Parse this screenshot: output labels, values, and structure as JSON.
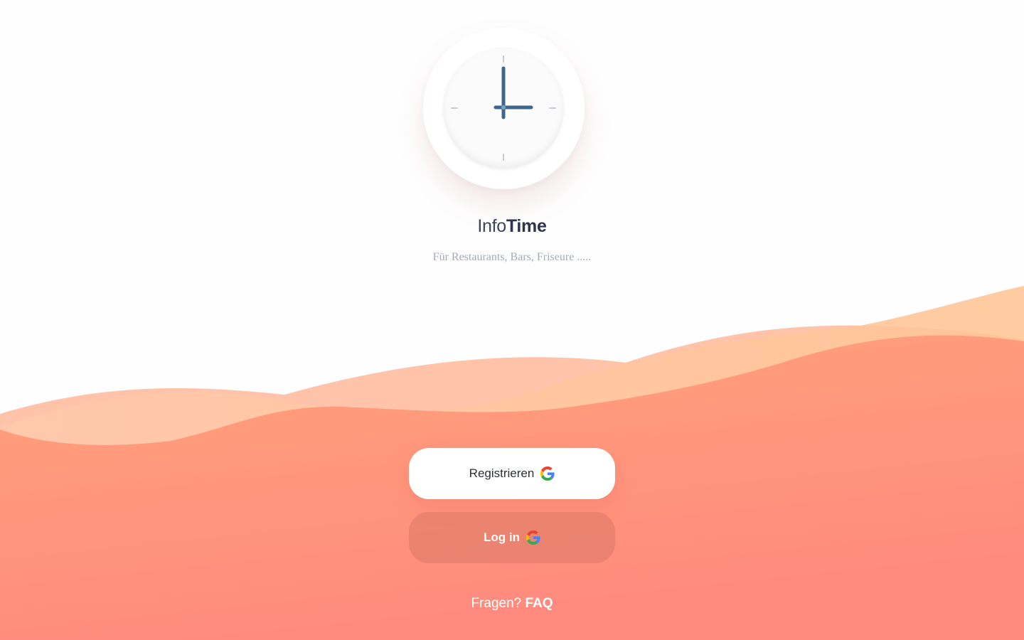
{
  "brand": {
    "name_light": "Info",
    "name_bold": "Time",
    "tagline": "Für Restaurants, Bars, Friseure ....."
  },
  "clock": {
    "icon": "clock-icon",
    "time": "3:00"
  },
  "buttons": {
    "register_label": "Registrieren",
    "login_label": "Log in",
    "provider_icon": "google-icon"
  },
  "footer": {
    "question": "Fragen?",
    "faq_label": "FAQ"
  },
  "colors": {
    "wave_light": "#ffc3a0",
    "wave_mid": "#ffa07a",
    "wave_bottom": "#ff8c80",
    "hand_color": "#40668f",
    "text_dark": "#2b3550",
    "tagline": "#a2adbc"
  }
}
